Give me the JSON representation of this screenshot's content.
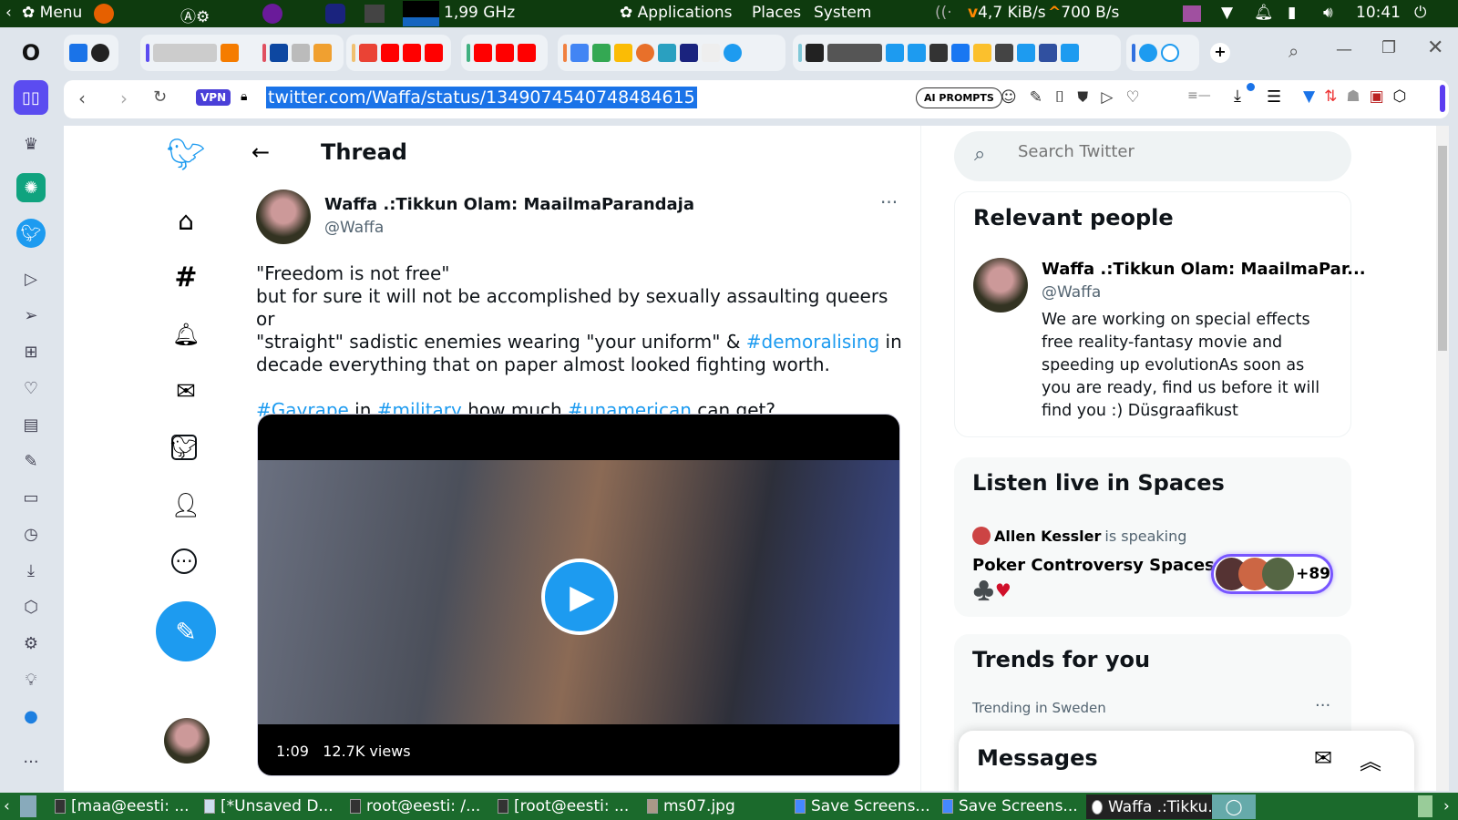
{
  "panel": {
    "menu": "Menu",
    "cpu": "1,99 GHz",
    "applications": "Applications",
    "places": "Places",
    "system": "System",
    "net_down": "4,7 KiB/s",
    "net_up": "700 B/s",
    "clock": "10:41"
  },
  "taskbar": [
    "[maa@eesti: ...",
    "[*Unsaved D...",
    "root@eesti: /...",
    "[root@eesti: ...",
    "ms07.jpg",
    "Save Screens...",
    "Save Screens...",
    "Waffa .:Tikku..."
  ],
  "browser": {
    "url": "twitter.com/Waffa/status/1349074540748484615",
    "vpn": "VPN",
    "ai_prompts": "AI PROMPTS",
    "download_badge_color": "#1a73e8"
  },
  "thread": {
    "title": "Thread",
    "name": "Waffa .:Tikkun Olam: MaailmaParandaja",
    "handle": "@Waffa",
    "line1": "\"Freedom is not free\"",
    "line2": "but for sure it will not be accomplished by sexually assaulting queers or",
    "line3a": "\"straight\" sadistic enemies wearing \"your uniform\" & ",
    "tag1": "#demoralising",
    "line3b": " in",
    "line4": "decade everything that on paper almost looked fighting worth.",
    "tag2": "#Gayrape",
    "in": " in ",
    "tag3": "#military",
    "mid": ",how much ",
    "tag4": "#unamerican",
    "end": " can get?",
    "video_duration": "1:09",
    "video_views": "12.7K views"
  },
  "search": {
    "placeholder": "Search Twitter"
  },
  "relevant": {
    "title": "Relevant people",
    "name": "Waffa .:Tikkun Olam: MaailmaPar...",
    "handle": "@Waffa",
    "bio": "We are working on special effects free reality-fantasy movie and speeding up evolutionAs soon as you are ready, find us before it will find you :) Düsgraafikust"
  },
  "spaces": {
    "title": "Listen live in Spaces",
    "speaker": "Allen Kessler",
    "speaking": " is speaking",
    "space_title": "Poker Controversy Spaces",
    "emoji": "♣️",
    "heart": "♥",
    "count": "+89"
  },
  "trends": {
    "title": "Trends for you",
    "context": "Trending in Sweden"
  },
  "messages": {
    "title": "Messages"
  },
  "accent": "#1d9bf0"
}
